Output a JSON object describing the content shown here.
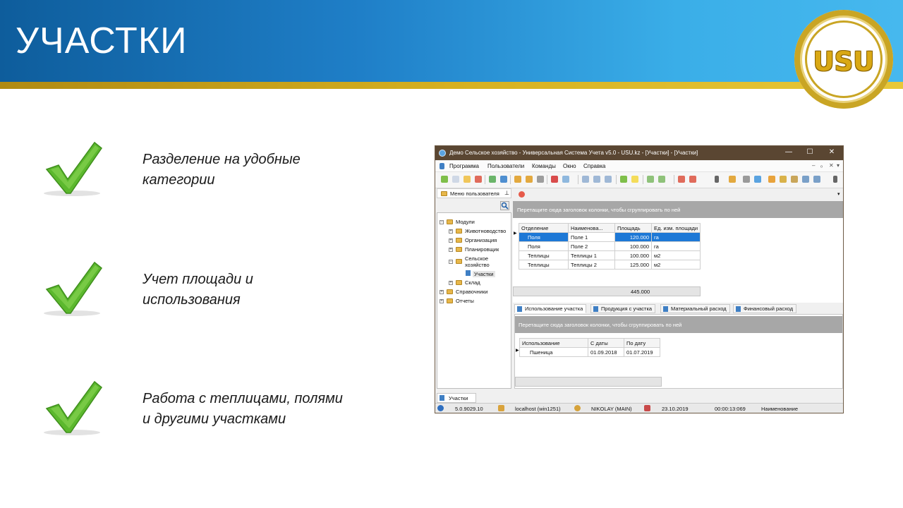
{
  "slide": {
    "title": "УЧАСТКИ",
    "logo_text": "USU",
    "colors": {
      "header_blue": "#1f7fc8",
      "stripe_gold": "#d6b020",
      "check_green": "#5cb82e"
    },
    "bullets": [
      {
        "icon": "checkmark-icon",
        "text": "Разделение на удобные\nкатегории"
      },
      {
        "icon": "checkmark-icon",
        "text": "Учет площади и\nиспользования"
      },
      {
        "icon": "checkmark-icon",
        "text": "Работа с теплицами, полями\nи другими участками"
      }
    ]
  },
  "app": {
    "window_title": "Демо Сельское хозяйство - Универсальная Система Учета v5.0 - USU.kz - [Участки] - [Участки]",
    "window_controls": {
      "minimize": "—",
      "maximize": "☐",
      "close": "✕"
    },
    "menu": [
      "Программа",
      "Пользователи",
      "Команды",
      "Окно",
      "Справка"
    ],
    "menu_controls": [
      "–",
      "ₒ",
      "✕",
      "▾"
    ],
    "user_menu_tab": "Меню пользователя",
    "tree": {
      "root": "Модули",
      "modules": [
        "Животноводство",
        "Организация",
        "Планировщик"
      ],
      "agri": "Сельское\nхозяйство",
      "agri_child": "Участки",
      "warehouse": "Склад",
      "references": "Справочники",
      "reports": "Отчеты"
    },
    "group_hint": "Перетащите сюда заголовок колонки, чтобы сгруппировать по ней",
    "main_grid": {
      "columns": [
        "Отделение",
        "Наименова...",
        "Площадь",
        "Ед. изм. площади"
      ],
      "rows": [
        [
          "Поля",
          "Поле 1",
          "120.000",
          "га"
        ],
        [
          "Поля",
          "Поле 2",
          "100.000",
          "га"
        ],
        [
          "Теплицы",
          "Теплицы 1",
          "100.000",
          "м2"
        ],
        [
          "Теплицы",
          "Теплицы 2",
          "125.000",
          "м2"
        ]
      ],
      "total": "445.000"
    },
    "detail_tabs": [
      "Использование участка",
      "Продукция с участка",
      "Материальный расход",
      "Финансовый расход"
    ],
    "detail_grid": {
      "columns": [
        "Использование",
        "С даты",
        "По дату"
      ],
      "rows": [
        [
          "Пшеница",
          "01.09.2018",
          "01.07.2019"
        ]
      ]
    },
    "bottom_tab": "Участки",
    "status": {
      "version": "5.0.9029.10",
      "server": "localhost (win1251)",
      "user": "NIKOLAY (MAIN)",
      "date": "23.10.2019",
      "time": "00:00:13:069",
      "field": "Наименование"
    }
  }
}
